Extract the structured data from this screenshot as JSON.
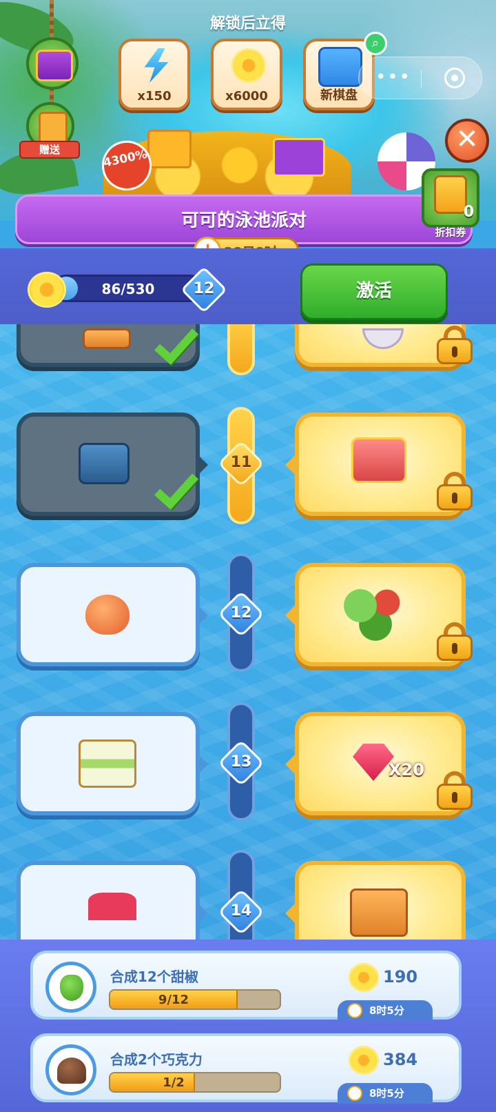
{
  "header": {
    "unlock_title": "解锁后立得",
    "rewards": [
      {
        "label": "x150",
        "icon": "energy-bolt-icon"
      },
      {
        "label": "x6000",
        "icon": "flower-coin-icon"
      },
      {
        "label": "新棋盘",
        "icon": "new-board-icon"
      }
    ],
    "gift_label": "赠送",
    "bonus_badge": "4300%",
    "coupon_count": "0",
    "coupon_label": "折扣券"
  },
  "event": {
    "title": "可可的泳池派对",
    "timer": "28日8时",
    "progress_text": "86/530",
    "progress_fraction": 0.162,
    "level": "12",
    "activate_label": "激活"
  },
  "track": {
    "levels": [
      {
        "level": "",
        "free_icon": "mystery-cube-icon",
        "paid_icon": "bowl-icon",
        "free_claimed": true,
        "paid_locked": true
      },
      {
        "level": "11",
        "free_icon": "blue-chest-icon",
        "paid_icon": "red-chest-icon",
        "free_claimed": true,
        "paid_locked": true
      },
      {
        "level": "12",
        "free_icon": "peach-icon",
        "paid_icon": "vegetables-icon",
        "free_claimed": false,
        "paid_locked": true
      },
      {
        "level": "13",
        "free_icon": "cake-tray-icon",
        "paid_icon": "ruby-gem-icon",
        "paid_count": "X20",
        "free_claimed": false,
        "paid_locked": true
      },
      {
        "level": "14",
        "free_icon": "ruby-pile-icon",
        "paid_icon": "mystery-cube-icon",
        "free_claimed": false,
        "paid_locked": true
      }
    ]
  },
  "tasks": [
    {
      "name": "合成12个甜椒",
      "progress_text": "9/12",
      "progress_fraction": 0.75,
      "reward": "190",
      "time_left": "8时5分",
      "icon": "bell-pepper-icon"
    },
    {
      "name": "合成2个巧克力",
      "progress_text": "1/2",
      "progress_fraction": 0.5,
      "reward": "384",
      "time_left": "8时5分",
      "icon": "chocolate-icon"
    }
  ]
}
